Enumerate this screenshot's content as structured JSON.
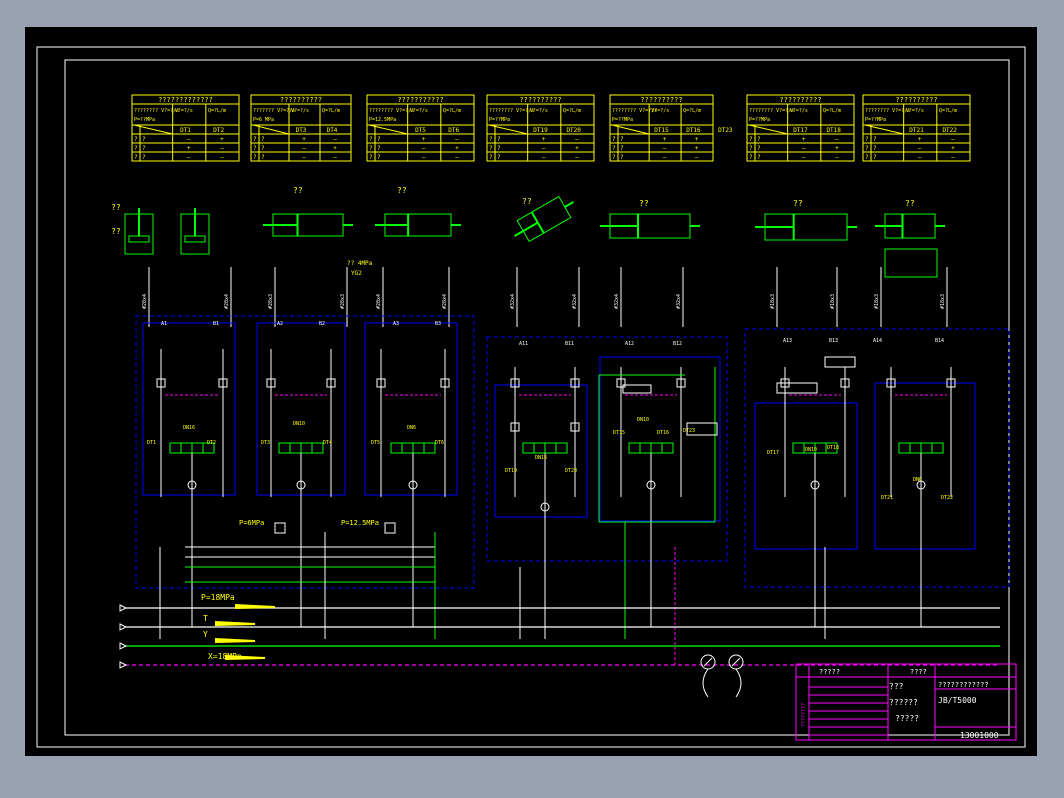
{
  "colors": {
    "background": "#99a2b3",
    "sheet": "#000000",
    "frame": "#ffffff",
    "table": "#ffff00",
    "pipe_white": "#ffffff",
    "pipe_green": "#00ff00",
    "pilot_magenta": "#ff00ff",
    "boundary_blue": "#0000ff",
    "title_block": "#ff00ff",
    "label_cyan": "#00ffff",
    "label_yellow": "#ffff00"
  },
  "tables": [
    {
      "title": "?????????????",
      "r1": [
        "???????? V?=?/s",
        "P=??MPa"
      ],
      "cols": [
        "",
        "?",
        "DT1",
        "DT2"
      ],
      "rows": [
        [
          "?",
          "?",
          "—",
          "+"
        ],
        [
          "?",
          "?",
          "+",
          "—"
        ],
        [
          "?",
          "?",
          "—",
          "—"
        ]
      ]
    },
    {
      "title": "??????????",
      "r1": [
        "??????? V?=?/s",
        "P=6 MPa"
      ],
      "cols": [
        "",
        "?",
        "DT3",
        "DT4"
      ],
      "rows": [
        [
          "?",
          "?",
          "+",
          "—"
        ],
        [
          "?",
          "?",
          "—",
          "+"
        ],
        [
          "?",
          "?",
          "—",
          "—"
        ]
      ]
    },
    {
      "title": "???????????",
      "r1": [
        "???????? V?=?/s",
        "P=12.5MPa"
      ],
      "cols": [
        "",
        "?",
        "DT5",
        "DT6"
      ],
      "rows": [
        [
          "?",
          "?",
          "+",
          "—"
        ],
        [
          "?",
          "?",
          "—",
          "+"
        ],
        [
          "?",
          "?",
          "—",
          "—"
        ]
      ]
    },
    {
      "title": "??????????",
      "r1": [
        "???????? V?=?/s",
        "P=??MPa"
      ],
      "cols": [
        "",
        "?",
        "DT19",
        "DT20"
      ],
      "rows": [
        [
          "?",
          "?",
          "+",
          "—"
        ],
        [
          "?",
          "?",
          "—",
          "+"
        ],
        [
          "?",
          "?",
          "—",
          "—"
        ]
      ]
    },
    {
      "title": "??????????",
      "r1": [
        "???????? V?=?/s",
        "P=??MPa"
      ],
      "cols": [
        "",
        "?",
        "DT15",
        "DT16",
        "DT23"
      ],
      "rows": [
        [
          "?",
          "?",
          "+",
          "+"
        ],
        [
          "?",
          "?",
          "—",
          "+"
        ],
        [
          "?",
          "?",
          "—",
          "—"
        ]
      ]
    },
    {
      "title": "??????????",
      "r1": [
        "???????? V?=?/s",
        "P=??MPa"
      ],
      "cols": [
        "",
        "?",
        "DT17",
        "DT18"
      ],
      "rows": [
        [
          "?",
          "?",
          "+",
          "—"
        ],
        [
          "?",
          "?",
          "—",
          "+"
        ],
        [
          "?",
          "?",
          "—",
          "—"
        ]
      ]
    },
    {
      "title": "??????????",
      "r1": [
        "???????? V?=?/s",
        "P=??MPa"
      ],
      "cols": [
        "",
        "?",
        "DT21",
        "DT22"
      ],
      "rows": [
        [
          "?",
          "?",
          "+",
          "—"
        ],
        [
          "?",
          "?",
          "—",
          "+"
        ],
        [
          "?",
          "?",
          "—",
          "—"
        ]
      ]
    }
  ],
  "actuator_labels": [
    {
      "top": "??",
      "mid": "??"
    },
    {
      "top": "??",
      "mid": "??"
    },
    {
      "top": "??",
      "mid": "??"
    },
    {
      "top": "??",
      "mid": "??"
    },
    {
      "top": "??",
      "mid": "??"
    },
    {
      "top": "??",
      "mid": "??"
    },
    {
      "top": "??",
      "mid": "??"
    }
  ],
  "port_labels": [
    "A1",
    "B1",
    "A2",
    "B2",
    "A3",
    "B3",
    "A11",
    "B11",
    "A12",
    "B12",
    "A13",
    "B13",
    "A14",
    "B14"
  ],
  "valve_labels": [
    "DT1",
    "DT2",
    "DT3",
    "DT4",
    "DT5",
    "DT6",
    "DT19",
    "DT20",
    "DT15",
    "DT16",
    "DT23",
    "DT17",
    "DT18",
    "DT21",
    "DT22"
  ],
  "manifold_labels": [
    "DN16",
    "DN10",
    "DN6",
    "DN16",
    "DN10",
    "DN10",
    "DN6"
  ],
  "pressure_notes": [
    "P=6MPa",
    "P=12.5MPa",
    "?? 4MPa",
    "YG2"
  ],
  "pipe_sizes": [
    "#28x4",
    "#28x4",
    "#28x3",
    "#28x3",
    "#28x4",
    "#28x4",
    "#32x4",
    "#32x4",
    "#32x4",
    "#32x4",
    "#18x3",
    "#18x3",
    "#18x3",
    "#18x3"
  ],
  "lines": {
    "p": "P=18MPa",
    "t": "T",
    "y": "Y",
    "x": "X=18MPa"
  },
  "title_block": {
    "row1": "?????",
    "row1b": "????",
    "name_top": "???",
    "name_main": "??????",
    "name_sub": "?????",
    "project": "????????????",
    "code": "JB/T5000",
    "drawing_no": "13001000",
    "side_label": "????????"
  }
}
